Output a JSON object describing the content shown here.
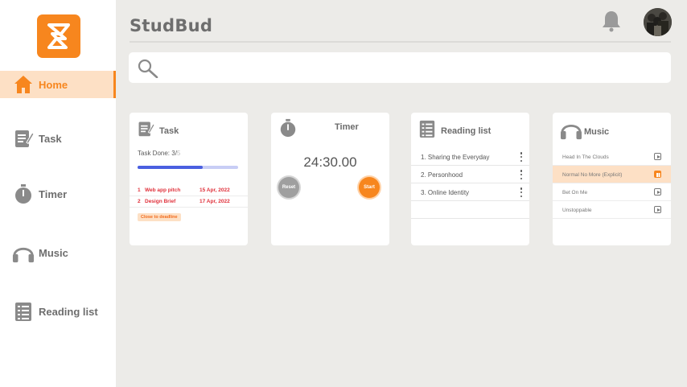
{
  "app": {
    "title": "StudBud"
  },
  "colors": {
    "accent": "#f7861e",
    "accent_light": "#fde0c5",
    "progress": "#4a5fe0",
    "deadline": "#e0313b"
  },
  "sidebar": {
    "items": [
      {
        "label": "Home",
        "icon": "home-icon",
        "active": true
      },
      {
        "label": "Task",
        "icon": "task-icon",
        "active": false
      },
      {
        "label": "Timer",
        "icon": "stopwatch-icon",
        "active": false
      },
      {
        "label": "Music",
        "icon": "headphones-icon",
        "active": false
      },
      {
        "label": "Reading list",
        "icon": "list-icon",
        "active": false
      }
    ]
  },
  "search": {
    "value": "",
    "placeholder": ""
  },
  "cards": {
    "task": {
      "title": "Task",
      "done_label": "Task Done: 3/",
      "done_total": "5",
      "progress": 0.65,
      "rows": [
        {
          "num": "1",
          "name": "Web app pitch",
          "date": "15 Apr, 2022"
        },
        {
          "num": "2",
          "name": "Design Brief",
          "date": "17 Apr, 2022"
        }
      ],
      "badge": "Close to deadline"
    },
    "timer": {
      "title": "Timer",
      "display": "24:30.00",
      "reset_label": "Reset",
      "start_label": "Start"
    },
    "reading": {
      "title": "Reading list",
      "items": [
        "1. Sharing the Everyday",
        "2. Personhood",
        "3. Online Identity"
      ]
    },
    "music": {
      "title": "Music",
      "tracks": [
        {
          "name": "Head In The Clouds",
          "active": false
        },
        {
          "name": "Normal No More (Explicit)",
          "active": true
        },
        {
          "name": "Bet On Me",
          "active": false
        },
        {
          "name": "Unstoppable",
          "active": false
        }
      ]
    }
  }
}
